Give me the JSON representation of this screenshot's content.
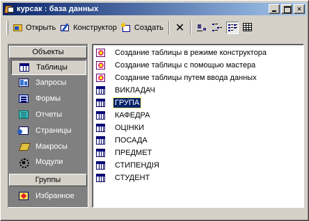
{
  "window": {
    "title": "курсак : база данных"
  },
  "toolbar": {
    "open_label": "Открыть",
    "design_label": "Конструктор",
    "create_label": "Создать",
    "delete_symbol": "✕"
  },
  "nav": {
    "objects_header": "Объекты",
    "groups_header": "Группы",
    "items": [
      {
        "label": "Таблицы",
        "icon": "table-icon"
      },
      {
        "label": "Запросы",
        "icon": "query-icon"
      },
      {
        "label": "Формы",
        "icon": "form-icon"
      },
      {
        "label": "Отчеты",
        "icon": "report-icon"
      },
      {
        "label": "Страницы",
        "icon": "page-icon"
      },
      {
        "label": "Макросы",
        "icon": "macro-icon"
      },
      {
        "label": "Модули",
        "icon": "module-icon"
      }
    ],
    "groups": [
      {
        "label": "Избранное",
        "icon": "favorites-icon"
      }
    ],
    "selected": "Таблицы"
  },
  "list": {
    "shortcuts": [
      "Создание таблицы в режиме конструктора",
      "Создание таблицы с помощью мастера",
      "Создание таблицы путем ввода данных"
    ],
    "tables": [
      "ВИКЛАДАЧ",
      "ГРУПА",
      "КАФЕДРА",
      "ОЦІНКИ",
      "ПОСАДА",
      "ПРЕДМЕТ",
      "СТИПЕНДІЯ",
      "СТУДЕНТ"
    ],
    "selected": "ГРУПА"
  },
  "colors": {
    "titlebar_start": "#0a246a",
    "titlebar_end": "#a6caf0",
    "face": "#d4d0c8",
    "nav_background": "#808080"
  }
}
